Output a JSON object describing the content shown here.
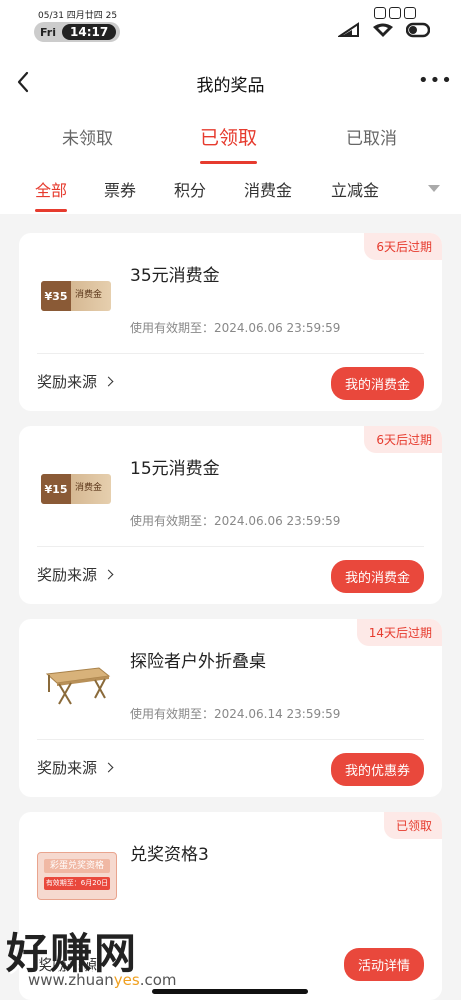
{
  "status_bar": {
    "date": "05/31 四月廿四 25",
    "day": "Fri",
    "time": "14:17"
  },
  "header": {
    "title": "我的奖品",
    "back_icon": "chevron-left-icon",
    "more_icon": "more-dots-icon",
    "more_glyph": "•••"
  },
  "main_tabs": [
    {
      "label": "未领取",
      "active": false
    },
    {
      "label": "已领取",
      "active": true
    },
    {
      "label": "已取消",
      "active": false
    }
  ],
  "sub_tabs": [
    {
      "label": "全部",
      "active": true
    },
    {
      "label": "票券",
      "active": false
    },
    {
      "label": "积分",
      "active": false
    },
    {
      "label": "消费金",
      "active": false
    },
    {
      "label": "立减金",
      "active": false
    }
  ],
  "cards": [
    {
      "badge": "6天后过期",
      "name": "35元消费金",
      "expiry": "使用有效期至：2024.06.06 23:59:59",
      "source": "奖励来源",
      "action": "我的消费金",
      "thumb_amount": "¥35",
      "thumb_label": "消费金"
    },
    {
      "badge": "6天后过期",
      "name": "15元消费金",
      "expiry": "使用有效期至：2024.06.06 23:59:59",
      "source": "奖励来源",
      "action": "我的消费金",
      "thumb_amount": "¥15",
      "thumb_label": "消费金"
    },
    {
      "badge": "14天后过期",
      "name": "探险者户外折叠桌",
      "expiry": "使用有效期至：2024.06.14 23:59:59",
      "source": "奖励来源",
      "action": "我的优惠券"
    },
    {
      "badge": "已领取",
      "name": "兑奖资格3",
      "thumb_title": "彩蛋兑奖资格",
      "thumb_expiry": "有效期至：6月20日",
      "source": "奖励来源",
      "action": "活动详情"
    }
  ],
  "watermark": {
    "logo": "好赚网",
    "url_prefix": "www.zhuan",
    "url_accent": "yes",
    "url_suffix": ".com"
  },
  "colors": {
    "accent": "#e63b2e",
    "badge_bg": "#fde9e7",
    "button_bg": "#e9483c",
    "page_bg": "#f4f4f4"
  }
}
